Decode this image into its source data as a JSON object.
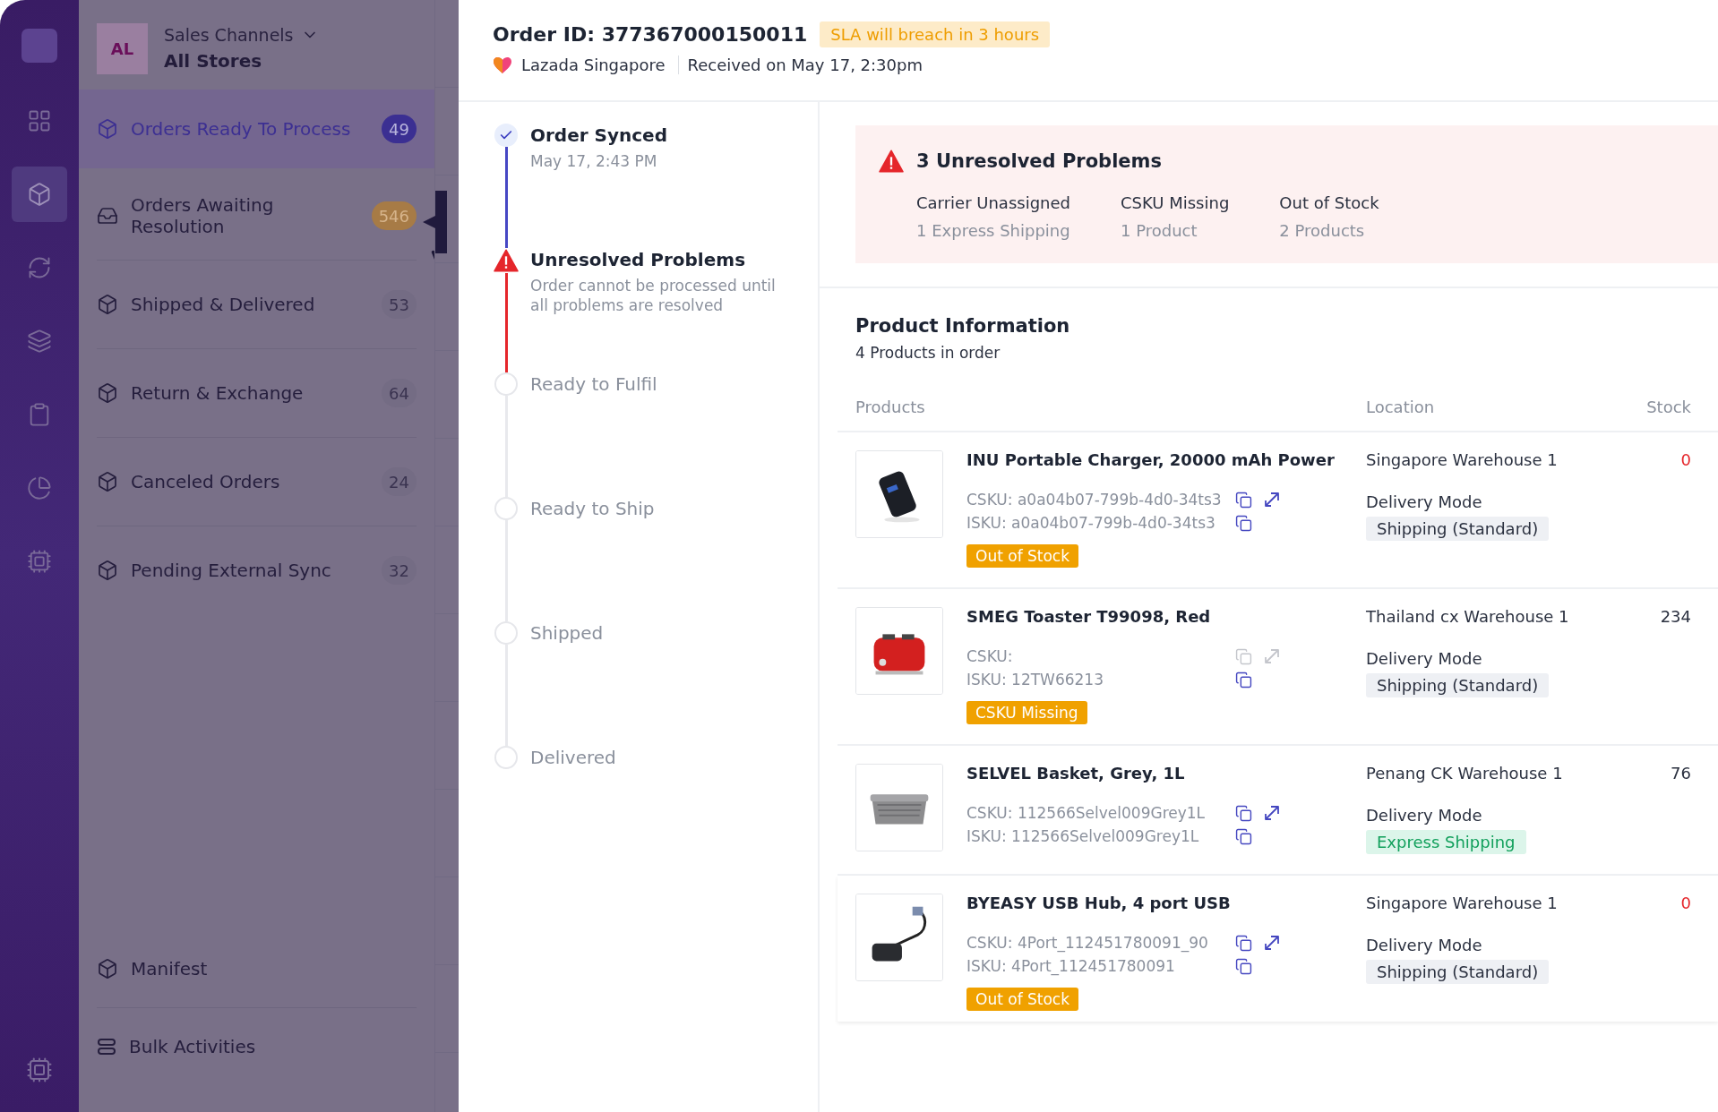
{
  "rail": {
    "items": [
      {
        "selected": false
      },
      {
        "selected": true
      },
      {
        "selected": false
      },
      {
        "selected": false
      },
      {
        "selected": false
      },
      {
        "selected": false
      },
      {
        "selected": false
      }
    ]
  },
  "sidebar": {
    "avatar": "AL",
    "channel_label": "Sales Channels",
    "channel_value": "All Stores",
    "items": [
      {
        "label": "Orders Ready To Process",
        "count": "49",
        "selected": true,
        "warning": false
      },
      {
        "label": "Orders Awaiting Resolution",
        "count": "546",
        "selected": false,
        "warning": true
      },
      {
        "label": "Shipped & Delivered",
        "count": "53",
        "selected": false,
        "warning": false
      },
      {
        "label": "Return & Exchange",
        "count": "64",
        "selected": false,
        "warning": false
      },
      {
        "label": "Canceled Orders",
        "count": "24",
        "selected": false,
        "warning": false
      },
      {
        "label": "Pending External Sync",
        "count": "32",
        "selected": false,
        "warning": false
      }
    ],
    "bottom_items": [
      {
        "label": "Manifest",
        "kind": "box"
      },
      {
        "label": "Bulk Activities",
        "kind": "stack"
      }
    ]
  },
  "order": {
    "title": "Order ID: 377367000150011",
    "sla": "SLA will breach in 3 hours",
    "store": "Lazada Singapore",
    "received": "Received on May 17, 2:30pm"
  },
  "timeline": [
    {
      "title": "Order Synced",
      "detail": "May 17, 2:43 PM",
      "kind": "done"
    },
    {
      "title": "Unresolved Problems",
      "detail": "Order cannot be processed until all problems are resolved",
      "kind": "problem"
    },
    {
      "title": "Ready to Fulfil",
      "kind": "pending"
    },
    {
      "title": "Ready to Ship",
      "kind": "pending"
    },
    {
      "title": "Shipped",
      "kind": "pending"
    },
    {
      "title": "Delivered",
      "kind": "pending"
    }
  ],
  "problems": {
    "title": "3 Unresolved Problems",
    "items": [
      {
        "label": "Carrier Unassigned",
        "detail": "1 Express Shipping"
      },
      {
        "label": "CSKU Missing",
        "detail": "1 Product"
      },
      {
        "label": "Out of Stock",
        "detail": "2 Products"
      }
    ]
  },
  "products": {
    "title": "Product Information",
    "subtitle": "4 Products in order",
    "columns": [
      "Products",
      "Location",
      "Stock"
    ],
    "rows": [
      {
        "name": "INU Portable Charger, 20000 mAh Power",
        "csku": "CSKU: a0a04b07-799b-4d0-34ts3",
        "csku_disabled": false,
        "isku": "ISKU: a0a04b07-799b-4d0-34ts3",
        "issue": "Out of Stock",
        "location": "Singapore Warehouse 1",
        "delivery_label": "Delivery Mode",
        "delivery": "Shipping (Standard)",
        "kind": "standard",
        "stock": "0",
        "stock_out": true
      },
      {
        "name": "SMEG Toaster T99098, Red",
        "csku": "CSKU:",
        "csku_disabled": true,
        "isku": "ISKU: 12TW66213",
        "issue": "CSKU Missing",
        "location": "Thailand cx Warehouse 1",
        "delivery_label": "Delivery Mode",
        "delivery": "Shipping (Standard)",
        "kind": "standard",
        "stock": "234",
        "stock_out": false
      },
      {
        "name": "SELVEL Basket, Grey, 1L",
        "csku": "CSKU: 112566Selvel009Grey1L",
        "csku_disabled": false,
        "isku": "ISKU: 112566Selvel009Grey1L",
        "location": "Penang CK Warehouse 1",
        "delivery_label": "Delivery Mode",
        "delivery": "Express Shipping",
        "kind": "express",
        "stock": "76",
        "stock_out": false
      },
      {
        "name": "BYEASY USB Hub, 4 port USB",
        "csku": "CSKU: 4Port_112451780091_90",
        "csku_disabled": false,
        "isku": "ISKU: 4Port_112451780091",
        "issue": "Out of Stock",
        "location": "Singapore Warehouse 1",
        "delivery_label": "Delivery Mode",
        "delivery": "Shipping (Standard)",
        "kind": "standard",
        "stock": "0",
        "stock_out": true
      }
    ]
  }
}
